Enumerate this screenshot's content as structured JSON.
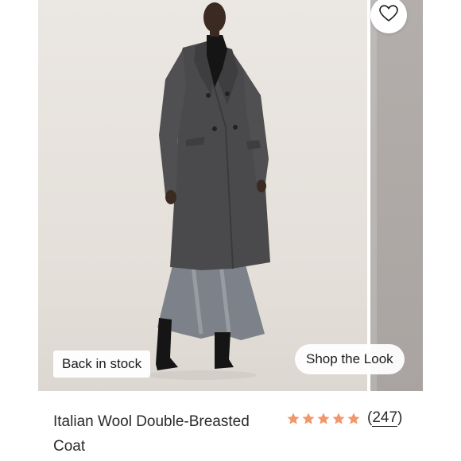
{
  "product": {
    "title": "Italian Wool Double-Breasted Coat",
    "badge": "Back in stock",
    "shop_look": "Shop the Look",
    "review_open": "(",
    "review_count": "247",
    "review_close": ")",
    "rating": 5,
    "rating_max": 5
  },
  "icons": {
    "wishlist": "heart-outline-icon",
    "star": "star-filled-icon"
  },
  "colors": {
    "star": "#f3966a",
    "text": "#2a2a2a",
    "photo_background": "#e8e4df"
  }
}
